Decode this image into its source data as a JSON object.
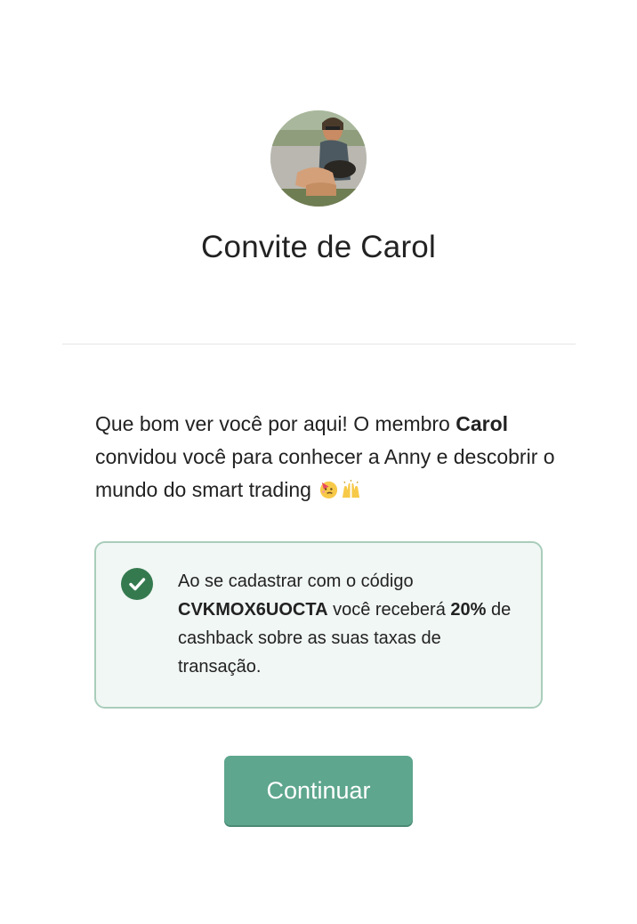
{
  "header": {
    "avatar_alt": "Carol",
    "title": "Convite de Carol"
  },
  "intro": {
    "part1": "Que bom ver você por aqui! O membro ",
    "member_name": "Carol",
    "part2": " convidou você para conhecer a Anny e descobrir o mundo do smart trading ",
    "emojis": [
      "partying-face-emoji",
      "raising-hands-emoji"
    ]
  },
  "referral": {
    "text_before_code": "Ao se cadastrar com o código ",
    "code": "CVKMOX6UOCTA",
    "text_middle": " você receberá ",
    "percent": "20%",
    "text_after": " de cashback sobre as suas taxas de transação."
  },
  "actions": {
    "continue_label": "Continuar"
  },
  "colors": {
    "accent": "#5ea68e",
    "check": "#357a4f",
    "box_bg": "#f1f7f4",
    "box_border": "#a9cdbb"
  }
}
